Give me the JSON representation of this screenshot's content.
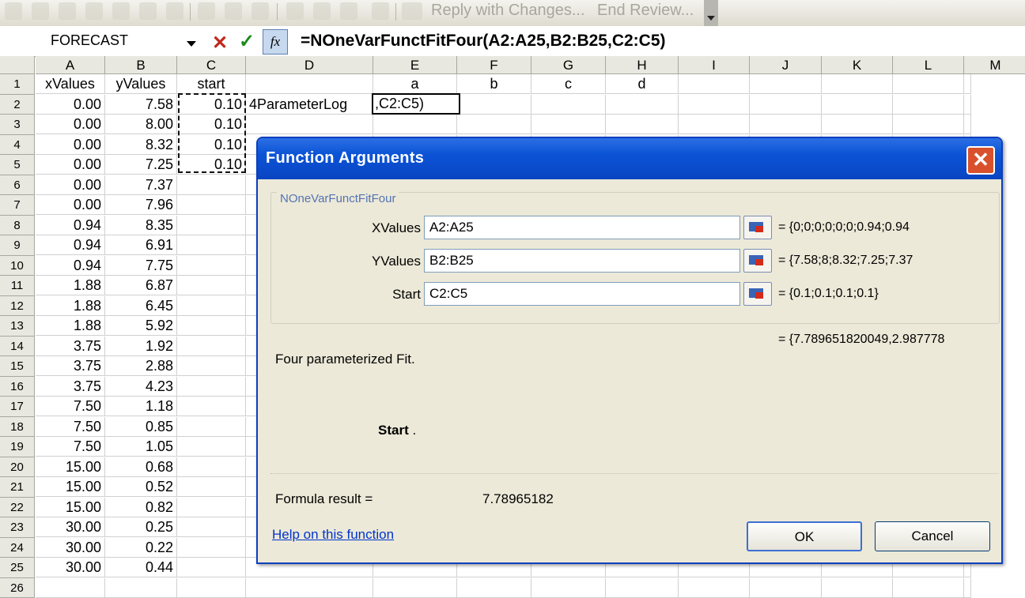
{
  "toolbar": {
    "reply_label": "Reply with Changes...",
    "end_review_label": "End Review..."
  },
  "formula_bar": {
    "name_box": "FORECAST",
    "cancel_symbol": "✕",
    "enter_symbol": "✓",
    "fx_label": "fx",
    "formula": "=NOneVarFunctFitFour(A2:A25,B2:B25,C2:C5)"
  },
  "sheet": {
    "columns": [
      "A",
      "B",
      "C",
      "D",
      "E",
      "F",
      "G",
      "H",
      "I",
      "J",
      "K",
      "L",
      "M"
    ],
    "row_numbers": [
      "1",
      "2",
      "3",
      "4",
      "5",
      "6",
      "7",
      "8",
      "9",
      "10",
      "11",
      "12",
      "13",
      "14",
      "15",
      "16",
      "17",
      "18",
      "19",
      "20",
      "21",
      "22",
      "23",
      "24",
      "25",
      "26"
    ],
    "header_row": {
      "A": "xValues",
      "B": "yValues",
      "C": "start",
      "E": "a",
      "F": "b",
      "G": "c",
      "H": "d"
    },
    "x_values": [
      "0.00",
      "0.00",
      "0.00",
      "0.00",
      "0.00",
      "0.00",
      "0.94",
      "0.94",
      "0.94",
      "1.88",
      "1.88",
      "1.88",
      "3.75",
      "3.75",
      "3.75",
      "7.50",
      "7.50",
      "7.50",
      "15.00",
      "15.00",
      "15.00",
      "30.00",
      "30.00",
      "30.00"
    ],
    "y_values": [
      "7.58",
      "8.00",
      "8.32",
      "7.25",
      "7.37",
      "7.96",
      "8.35",
      "6.91",
      "7.75",
      "6.87",
      "6.45",
      "5.92",
      "1.92",
      "2.88",
      "4.23",
      "1.18",
      "0.85",
      "1.05",
      "0.68",
      "0.52",
      "0.82",
      "0.25",
      "0.22",
      "0.44"
    ],
    "start_values": [
      "0.10",
      "0.10",
      "0.10",
      "0.10"
    ],
    "d2": "4ParameterLog",
    "e2_editing": ",C2:C5)"
  },
  "dialog": {
    "title": "Function Arguments",
    "close_symbol": "✕",
    "function_name": "NOneVarFunctFitFour",
    "args": [
      {
        "label": "XValues",
        "value": "A2:A25",
        "result": "=  {0;0;0;0;0;0;0.94;0.94"
      },
      {
        "label": "YValues",
        "value": "B2:B25",
        "result": "=  {7.58;8;8.32;7.25;7.37"
      },
      {
        "label": "Start",
        "value": "C2:C5",
        "result": "=  {0.1;0.1;0.1;0.1}"
      }
    ],
    "overall_result": "=  {7.789651820049,2.987778",
    "description": "Four parameterized Fit.",
    "arg_help_name": "Start",
    "arg_help_text": " .",
    "formula_result_label": "Formula result =",
    "formula_result_value": "7.78965182",
    "help_link": "Help on this function",
    "ok_label": "OK",
    "cancel_label": "Cancel"
  }
}
